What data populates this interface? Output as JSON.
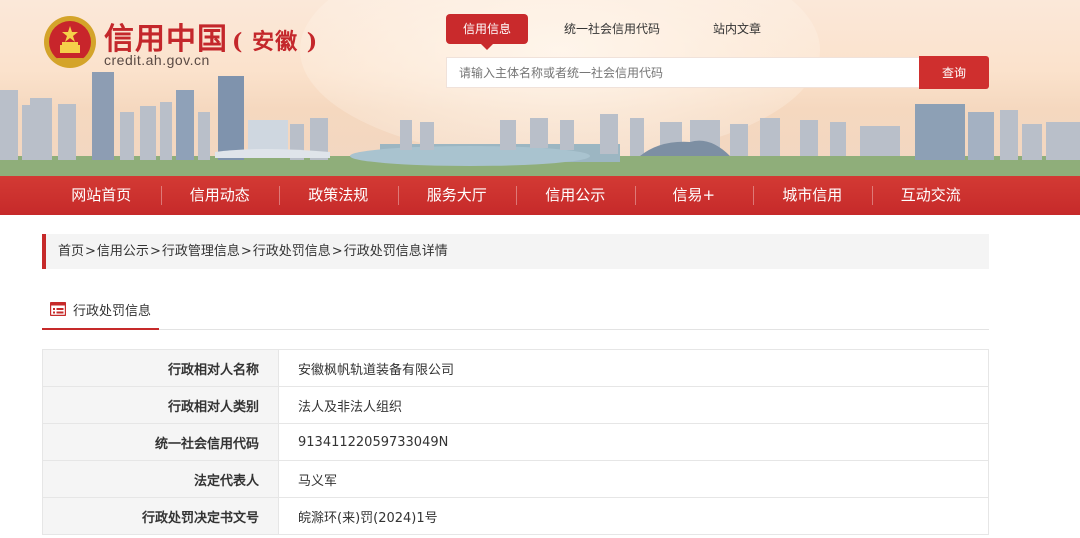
{
  "logo": {
    "main_title": "信用中国",
    "region": "( 安徽 )",
    "domain": "credit.ah.gov.cn"
  },
  "top_tabs": [
    {
      "label": "信用信息",
      "active": true
    },
    {
      "label": "统一社会信用代码",
      "active": false
    },
    {
      "label": "站内文章",
      "active": false
    }
  ],
  "search": {
    "placeholder": "请输入主体名称或者统一社会信用代码",
    "button_label": "查询"
  },
  "nav": {
    "items": [
      {
        "label": "网站首页"
      },
      {
        "label": "信用动态"
      },
      {
        "label": "政策法规"
      },
      {
        "label": "服务大厅"
      },
      {
        "label": "信用公示"
      },
      {
        "label": "信易+"
      },
      {
        "label": "城市信用"
      },
      {
        "label": "互动交流"
      }
    ]
  },
  "breadcrumb": {
    "items": [
      "首页",
      "信用公示",
      " 行政管理信息",
      " 行政处罚信息",
      "行政处罚信息详情"
    ],
    "separator": ">"
  },
  "section": {
    "title": "行政处罚信息",
    "icon": "document-list-icon"
  },
  "details": {
    "rows": [
      {
        "label": "行政相对人名称",
        "value": "安徽枫帆轨道装备有限公司"
      },
      {
        "label": "行政相对人类别",
        "value": "法人及非法人组织"
      },
      {
        "label": "统一社会信用代码",
        "value": "91341122059733049N"
      },
      {
        "label": "法定代表人",
        "value": "马义军"
      },
      {
        "label": "行政处罚决定书文号",
        "value": "皖滁环(来)罚(2024)1号"
      }
    ]
  },
  "colors": {
    "brand_red": "#c62a2a",
    "banner_bg": "#fbe2cc",
    "label_bg": "#f5f5f5"
  }
}
